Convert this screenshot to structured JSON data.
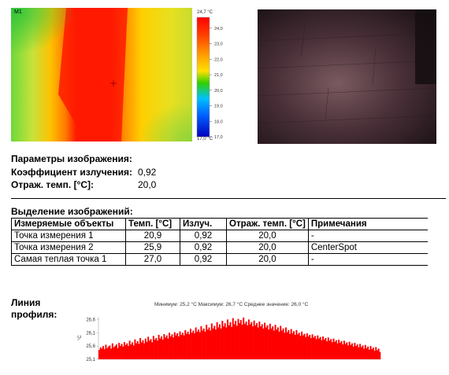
{
  "thermal": {
    "marker_m1": "M1",
    "scale_max": "24,7 °C",
    "scale_min": "17,0 °C",
    "scale_ticks": [
      "24,0",
      "23,0",
      "22,0",
      "21,0",
      "20,0",
      "19,0",
      "18,0",
      "17,0"
    ],
    "scale_tick_values": [
      24.0,
      23.0,
      22.0,
      21.0,
      20.0,
      19.0,
      18.0,
      17.0
    ],
    "scale_range": [
      17.0,
      24.7
    ]
  },
  "params": {
    "heading": "Параметры изображения:",
    "emissivity_label": "Коэффициент излучения:",
    "emissivity_value": "0,92",
    "reflected_label": "Отраж. темп. [°C]:",
    "reflected_value": "20,0"
  },
  "selection": {
    "heading": "Выделение изображений:",
    "columns": [
      "Измеряемые объекты",
      "Темп. [°C]",
      "Излуч.",
      "Отраж. темп. [°C]",
      "Примечания"
    ],
    "rows": [
      [
        "Точка измерения 1",
        "20,9",
        "0,92",
        "20,0",
        "-"
      ],
      [
        "Точка измерения 2",
        "25,9",
        "0,92",
        "20,0",
        "CenterSpot"
      ],
      [
        "Самая теплая точка 1",
        "27,0",
        "0,92",
        "20,0",
        "-"
      ]
    ]
  },
  "profile": {
    "label_line1": "Линия",
    "label_line2": "профиля:",
    "stats": "Минимум: 25,2 °C Максимум: 26,7 °C Среднее значение: 26,0 °C",
    "unit": "°C"
  },
  "chart_data": {
    "type": "bar",
    "ylabel": "°C",
    "ylim": [
      25.1,
      26.7
    ],
    "yticks": [
      "26,6",
      "26,1",
      "25,6",
      "25,1"
    ],
    "ytick_values": [
      26.6,
      26.1,
      25.6,
      25.1
    ],
    "color": "#ff0000",
    "values": [
      25.45,
      25.55,
      25.5,
      25.6,
      25.48,
      25.65,
      25.52,
      25.58,
      25.62,
      25.5,
      25.7,
      25.55,
      25.6,
      25.66,
      25.52,
      25.72,
      25.6,
      25.68,
      25.58,
      25.75,
      25.64,
      25.7,
      25.6,
      25.8,
      25.66,
      25.74,
      25.62,
      25.85,
      25.7,
      25.78,
      25.68,
      25.9,
      25.74,
      25.82,
      25.7,
      25.88,
      25.76,
      25.95,
      25.8,
      25.86,
      25.74,
      25.98,
      25.84,
      25.9,
      25.8,
      26.02,
      25.88,
      25.96,
      25.84,
      26.05,
      25.92,
      26.0,
      25.88,
      26.1,
      25.96,
      26.04,
      25.92,
      26.12,
      26.0,
      26.08,
      25.96,
      26.15,
      26.02,
      26.1,
      26.0,
      26.2,
      26.06,
      26.14,
      26.04,
      26.25,
      26.1,
      26.18,
      26.08,
      26.3,
      26.14,
      26.22,
      26.12,
      26.35,
      26.18,
      26.26,
      26.14,
      26.4,
      26.22,
      26.3,
      26.18,
      26.45,
      26.26,
      26.36,
      26.22,
      26.5,
      26.3,
      26.42,
      26.26,
      26.55,
      26.34,
      26.46,
      26.3,
      26.6,
      26.38,
      26.5,
      26.32,
      26.65,
      26.42,
      26.55,
      26.36,
      26.62,
      26.46,
      26.58,
      26.4,
      26.67,
      26.44,
      26.52,
      26.38,
      26.6,
      26.42,
      26.5,
      26.34,
      26.56,
      26.38,
      26.46,
      26.3,
      26.52,
      26.34,
      26.42,
      26.26,
      26.48,
      26.3,
      26.38,
      26.22,
      26.44,
      26.26,
      26.34,
      26.18,
      26.4,
      26.22,
      26.3,
      26.14,
      26.36,
      26.18,
      26.26,
      26.1,
      26.3,
      26.12,
      26.2,
      26.06,
      26.24,
      26.08,
      26.16,
      26.02,
      26.2,
      26.04,
      26.1,
      25.98,
      26.14,
      26.0,
      26.06,
      25.94,
      26.08,
      25.96,
      26.02,
      25.9,
      26.04,
      25.92,
      25.98,
      25.86,
      26.0,
      25.88,
      25.94,
      25.82,
      25.96,
      25.84,
      25.9,
      25.78,
      25.92,
      25.8,
      25.86,
      25.74,
      25.88,
      25.76,
      25.82,
      25.7,
      25.84,
      25.72,
      25.78,
      25.66,
      25.8,
      25.68,
      25.74,
      25.62,
      25.76,
      25.64,
      25.7,
      25.58,
      25.72,
      25.6,
      25.66,
      25.55,
      25.68,
      25.56,
      25.62,
      25.5,
      25.64,
      25.52,
      25.58,
      25.46,
      25.6,
      25.48,
      25.54,
      25.42,
      25.56,
      25.44,
      25.5,
      25.38
    ]
  }
}
